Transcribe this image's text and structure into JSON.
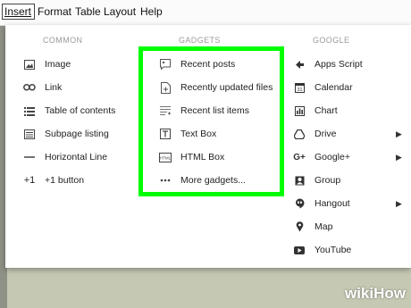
{
  "menubar": {
    "items": [
      "Insert",
      "Format",
      "Table",
      "Layout",
      "Help"
    ]
  },
  "common": {
    "header": "COMMON",
    "items": [
      {
        "label": "Image",
        "icon": "image-icon"
      },
      {
        "label": "Link",
        "icon": "link-icon"
      },
      {
        "label": "Table of contents",
        "icon": "toc-icon"
      },
      {
        "label": "Subpage listing",
        "icon": "subpage-icon"
      },
      {
        "label": "Horizontal Line",
        "icon": "hline-icon"
      },
      {
        "label": "+1 button",
        "icon": "plusone-icon",
        "glyph": "+1"
      }
    ]
  },
  "gadgets": {
    "header": "GADGETS",
    "items": [
      {
        "label": "Recent posts",
        "icon": "recent-posts-icon"
      },
      {
        "label": "Recently updated files",
        "icon": "updated-files-icon"
      },
      {
        "label": "Recent list items",
        "icon": "list-items-icon"
      },
      {
        "label": "Text Box",
        "icon": "textbox-icon"
      },
      {
        "label": "HTML Box",
        "icon": "htmlbox-icon"
      },
      {
        "label": "More gadgets...",
        "icon": "more-icon"
      }
    ]
  },
  "google": {
    "header": "GOOGLE",
    "items": [
      {
        "label": "Apps Script",
        "icon": "apps-script-icon"
      },
      {
        "label": "Calendar",
        "icon": "calendar-icon"
      },
      {
        "label": "Chart",
        "icon": "chart-icon"
      },
      {
        "label": "Drive",
        "icon": "drive-icon",
        "submenu": true
      },
      {
        "label": "Google+",
        "icon": "googleplus-icon",
        "submenu": true
      },
      {
        "label": "Group",
        "icon": "group-icon"
      },
      {
        "label": "Hangout",
        "icon": "hangout-icon",
        "submenu": true
      },
      {
        "label": "Map",
        "icon": "map-icon"
      },
      {
        "label": "YouTube",
        "icon": "youtube-icon"
      }
    ]
  },
  "watermark": {
    "wiki": "wiki",
    "how": "How"
  },
  "colors": {
    "highlight": "#00ff00"
  }
}
